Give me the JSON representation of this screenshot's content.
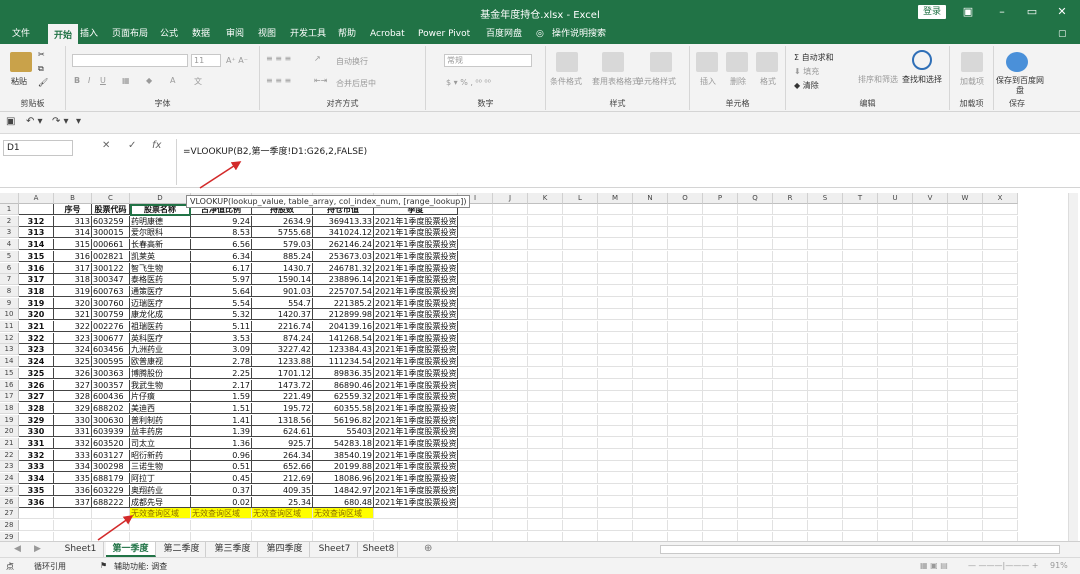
{
  "window": {
    "title": "基金年度持仓.xlsx - Excel",
    "login_label": "登录"
  },
  "ribbon_tabs": [
    "文件",
    "开始",
    "插入",
    "页面布局",
    "公式",
    "数据",
    "审阅",
    "视图",
    "开发工具",
    "帮助",
    "Acrobat",
    "Power Pivot",
    "百度网盘",
    "操作说明搜索"
  ],
  "active_tab": "开始",
  "ribbon": {
    "clipboard": {
      "paste": "粘贴",
      "label": "剪贴板"
    },
    "font": {
      "label": "字体",
      "font_size": "11"
    },
    "alignment": {
      "wrap": "自动换行",
      "merge": "合并后居中",
      "label": "对齐方式"
    },
    "number": {
      "format": "常规",
      "label": "数字"
    },
    "styles": {
      "cond": "条件格式",
      "table": "套用表格格式",
      "cell": "单元格样式",
      "label": "样式"
    },
    "cells": {
      "insert": "插入",
      "delete": "删除",
      "format": "格式",
      "label": "单元格"
    },
    "editing": {
      "autosum": "自动求和",
      "fill": "填充",
      "clear": "清除",
      "sort": "排序和筛选",
      "find": "查找和选择",
      "label": "编辑"
    },
    "addins": {
      "load": "加载项",
      "label": "加载项"
    },
    "save": {
      "btn": "保存到百度网盘",
      "label": "保存"
    }
  },
  "formula_bar": {
    "name_box": "D1",
    "formula": "=VLOOKUP(B2,第一季度!D1:G26,2,FALSE)",
    "tooltip": "VLOOKUP(lookup_value, table_array, col_index_num, [range_lookup])"
  },
  "columns": [
    "A",
    "B",
    "C",
    "D",
    "E",
    "F",
    "G",
    "H",
    "I",
    "J",
    "K",
    "L",
    "M",
    "N",
    "O",
    "P",
    "Q",
    "R",
    "S",
    "T",
    "U",
    "V",
    "W",
    "X"
  ],
  "headers": {
    "B": "序号",
    "C": "股票代码",
    "D": "股票名称",
    "E": "占净值比例",
    "F": "持股数",
    "G": "持仓市值",
    "H": "季度"
  },
  "rows": [
    {
      "a": "312",
      "b": "313",
      "c": "603259",
      "d": "药明康德",
      "e": "9.24",
      "f": "2634.9",
      "g": "369413.33",
      "h": "2021年1季度股票投资明细"
    },
    {
      "a": "313",
      "b": "314",
      "c": "300015",
      "d": "爱尔眼科",
      "e": "8.53",
      "f": "5755.68",
      "g": "341024.12",
      "h": "2021年1季度股票投资明细"
    },
    {
      "a": "314",
      "b": "315",
      "c": "000661",
      "d": "长春高新",
      "e": "6.56",
      "f": "579.03",
      "g": "262146.24",
      "h": "2021年1季度股票投资明细"
    },
    {
      "a": "315",
      "b": "316",
      "c": "002821",
      "d": "凯莱英",
      "e": "6.34",
      "f": "885.24",
      "g": "253673.03",
      "h": "2021年1季度股票投资明细"
    },
    {
      "a": "316",
      "b": "317",
      "c": "300122",
      "d": "智飞生物",
      "e": "6.17",
      "f": "1430.7",
      "g": "246781.32",
      "h": "2021年1季度股票投资明细"
    },
    {
      "a": "317",
      "b": "318",
      "c": "300347",
      "d": "泰格医药",
      "e": "5.97",
      "f": "1590.14",
      "g": "238896.14",
      "h": "2021年1季度股票投资明细"
    },
    {
      "a": "318",
      "b": "319",
      "c": "600763",
      "d": "通策医疗",
      "e": "5.64",
      "f": "901.03",
      "g": "225707.54",
      "h": "2021年1季度股票投资明细"
    },
    {
      "a": "319",
      "b": "320",
      "c": "300760",
      "d": "迈瑞医疗",
      "e": "5.54",
      "f": "554.7",
      "g": "221385.2",
      "h": "2021年1季度股票投资明细"
    },
    {
      "a": "320",
      "b": "321",
      "c": "300759",
      "d": "康龙化成",
      "e": "5.32",
      "f": "1420.37",
      "g": "212899.98",
      "h": "2021年1季度股票投资明细"
    },
    {
      "a": "321",
      "b": "322",
      "c": "002276",
      "d": "祖瑞医药",
      "e": "5.11",
      "f": "2216.74",
      "g": "204139.16",
      "h": "2021年1季度股票投资明细"
    },
    {
      "a": "322",
      "b": "323",
      "c": "300677",
      "d": "英科医疗",
      "e": "3.53",
      "f": "874.24",
      "g": "141268.54",
      "h": "2021年1季度股票投资明细"
    },
    {
      "a": "323",
      "b": "324",
      "c": "603456",
      "d": "九洲药业",
      "e": "3.09",
      "f": "3227.42",
      "g": "123384.43",
      "h": "2021年1季度股票投资明细"
    },
    {
      "a": "324",
      "b": "325",
      "c": "300595",
      "d": "欧普康视",
      "e": "2.78",
      "f": "1233.88",
      "g": "111234.54",
      "h": "2021年1季度股票投资明细"
    },
    {
      "a": "325",
      "b": "326",
      "c": "300363",
      "d": "博腾股份",
      "e": "2.25",
      "f": "1701.12",
      "g": "89836.35",
      "h": "2021年1季度股票投资明细"
    },
    {
      "a": "326",
      "b": "327",
      "c": "300357",
      "d": "我武生物",
      "e": "2.17",
      "f": "1473.72",
      "g": "86890.46",
      "h": "2021年1季度股票投资明细"
    },
    {
      "a": "327",
      "b": "328",
      "c": "600436",
      "d": "片仔癀",
      "e": "1.59",
      "f": "221.49",
      "g": "62559.32",
      "h": "2021年1季度股票投资明细"
    },
    {
      "a": "328",
      "b": "329",
      "c": "688202",
      "d": "美迪西",
      "e": "1.51",
      "f": "195.72",
      "g": "60355.58",
      "h": "2021年1季度股票投资明细"
    },
    {
      "a": "329",
      "b": "330",
      "c": "300630",
      "d": "普利制药",
      "e": "1.41",
      "f": "1318.56",
      "g": "56196.82",
      "h": "2021年1季度股票投资明细"
    },
    {
      "a": "330",
      "b": "331",
      "c": "603939",
      "d": "益丰药房",
      "e": "1.39",
      "f": "624.61",
      "g": "55403",
      "h": "2021年1季度股票投资明细"
    },
    {
      "a": "331",
      "b": "332",
      "c": "603520",
      "d": "司太立",
      "e": "1.36",
      "f": "925.7",
      "g": "54283.18",
      "h": "2021年1季度股票投资明细"
    },
    {
      "a": "332",
      "b": "333",
      "c": "603127",
      "d": "昭衍新药",
      "e": "0.96",
      "f": "264.34",
      "g": "38540.19",
      "h": "2021年1季度股票投资明细"
    },
    {
      "a": "333",
      "b": "334",
      "c": "300298",
      "d": "三诺生物",
      "e": "0.51",
      "f": "652.66",
      "g": "20199.88",
      "h": "2021年1季度股票投资明细"
    },
    {
      "a": "334",
      "b": "335",
      "c": "688179",
      "d": "阿拉丁",
      "e": "0.45",
      "f": "212.69",
      "g": "18086.96",
      "h": "2021年1季度股票投资明细"
    },
    {
      "a": "335",
      "b": "336",
      "c": "603229",
      "d": "奥翔药业",
      "e": "0.37",
      "f": "409.35",
      "g": "14842.97",
      "h": "2021年1季度股票投资明细"
    },
    {
      "a": "336",
      "b": "337",
      "c": "688222",
      "d": "成都先导",
      "e": "0.02",
      "f": "25.34",
      "g": "680.48",
      "h": "2021年1季度股票投资明细"
    }
  ],
  "invalid_label": "无效查询区域",
  "sheets": [
    "Sheet1",
    "第一季度",
    "第二季度",
    "第三季度",
    "第四季度",
    "Sheet7",
    "Sheet8"
  ],
  "active_sheet": "第一季度",
  "status": {
    "left1": "点",
    "left2": "循环引用",
    "accessibility": "辅助功能: 调查",
    "zoom": "91%"
  },
  "colors": {
    "excel_green": "#217346",
    "highlight": "#ffff00",
    "arrow": "#d32a2a"
  }
}
